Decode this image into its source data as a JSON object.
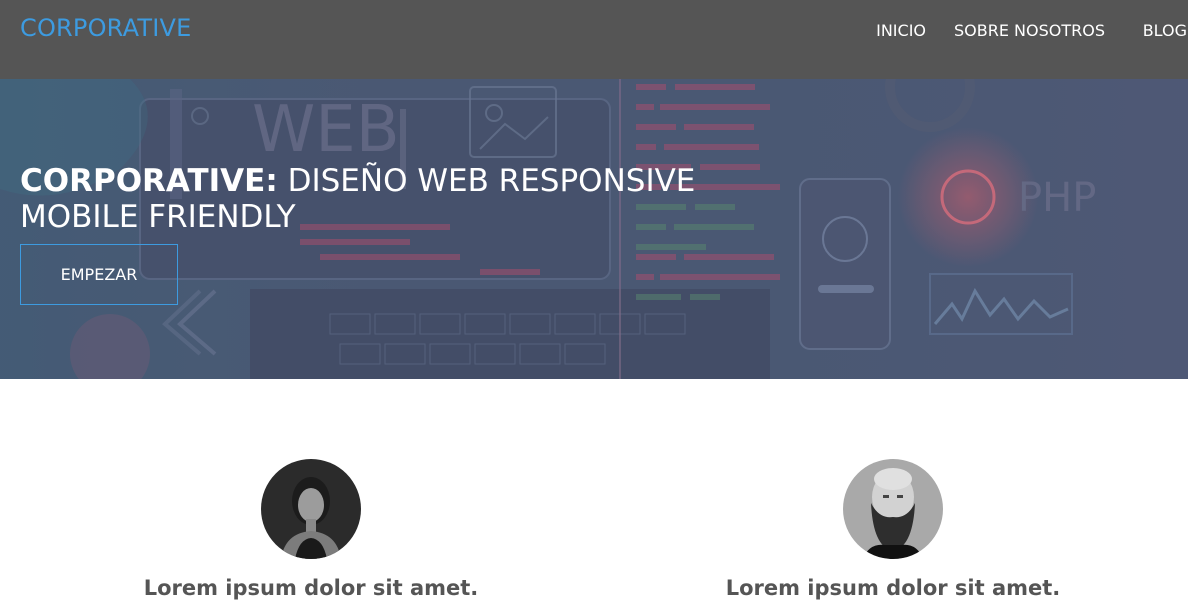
{
  "brand": {
    "logo": "CORPORATIVE",
    "accent": "#3d9be0"
  },
  "nav": {
    "items": [
      {
        "label": "INICIO"
      },
      {
        "label": "SOBRE NOSOTROS"
      },
      {
        "label": "BLOG"
      }
    ]
  },
  "hero": {
    "title_strong": "CORPORATIVE:",
    "title_rest": " DISEÑO WEB RESPONSIVE MOBILE FRIENDLY",
    "cta": "EMPEZAR",
    "bg_words": {
      "web": "WEB",
      "php": "PHP"
    }
  },
  "team": [
    {
      "name": "Lorem ipsum dolor sit amet.",
      "avatar": "woman-portrait"
    },
    {
      "name": "Lorem ipsum dolor sit amet.",
      "avatar": "bearded-man-portrait"
    }
  ],
  "colors": {
    "header_bg": "#555555",
    "hero_overlay": "#4a5773",
    "text_dark": "#555555"
  }
}
